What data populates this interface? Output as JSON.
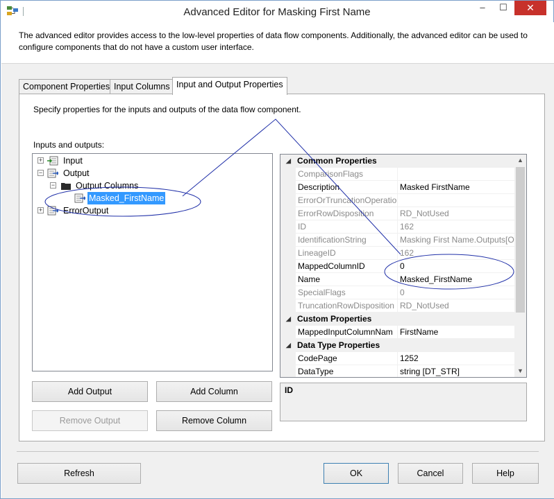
{
  "window": {
    "title": "Advanced Editor for Masking First Name",
    "description": "The advanced editor provides access to the low-level properties of data flow components. Additionally, the advanced editor can be used to configure components that do not have a custom user interface.",
    "controls": {
      "minimize": "‒",
      "maximize": "☐",
      "close": "✕"
    }
  },
  "tabs": [
    {
      "label": "Component Properties",
      "active": false
    },
    {
      "label": "Input Columns",
      "active": false
    },
    {
      "label": "Input and Output Properties",
      "active": true
    }
  ],
  "panel": {
    "info": "Specify properties for the inputs and outputs of the data flow component.",
    "tree_label": "Inputs and outputs:"
  },
  "tree": {
    "input": {
      "label": "Input",
      "expander": "+"
    },
    "output": {
      "label": "Output",
      "expander": "−"
    },
    "output_columns": {
      "label": "Output Columns",
      "expander": "−"
    },
    "masked_firstname": {
      "label": "Masked_FirstName",
      "selected": true
    },
    "error_output": {
      "label": "ErrorOutput",
      "expander": "+"
    }
  },
  "buttons": {
    "add_output": "Add Output",
    "add_column": "Add Column",
    "remove_output": "Remove Output",
    "remove_column": "Remove Column",
    "refresh": "Refresh",
    "ok": "OK",
    "cancel": "Cancel",
    "help": "Help"
  },
  "property_grid": {
    "common": {
      "label": "Common Properties",
      "rows": [
        {
          "name": "ComparisonFlags",
          "value": "",
          "readonly": true
        },
        {
          "name": "Description",
          "value": "Masked FirstName",
          "readonly": false
        },
        {
          "name": "ErrorOrTruncationOperatio",
          "value": "",
          "readonly": true
        },
        {
          "name": "ErrorRowDisposition",
          "value": "RD_NotUsed",
          "readonly": true
        },
        {
          "name": "ID",
          "value": "162",
          "readonly": true
        },
        {
          "name": "IdentificationString",
          "value": "Masking First Name.Outputs[O",
          "readonly": true
        },
        {
          "name": "LineageID",
          "value": "162",
          "readonly": true
        },
        {
          "name": "MappedColumnID",
          "value": "0",
          "readonly": false
        },
        {
          "name": "Name",
          "value": "Masked_FirstName",
          "readonly": false
        },
        {
          "name": "SpecialFlags",
          "value": "0",
          "readonly": true
        },
        {
          "name": "TruncationRowDisposition",
          "value": "RD_NotUsed",
          "readonly": true
        }
      ]
    },
    "custom": {
      "label": "Custom Properties",
      "rows": [
        {
          "name": "MappedInputColumnNam",
          "value": "FirstName",
          "readonly": false
        }
      ]
    },
    "datatype": {
      "label": "Data Type Properties",
      "rows": [
        {
          "name": "CodePage",
          "value": "1252",
          "readonly": false
        },
        {
          "name": "DataType",
          "value": "string [DT_STR]",
          "readonly": false
        }
      ]
    },
    "toggle_glyph": "◢",
    "scroll_up": "▲",
    "scroll_down": "▼"
  },
  "description_box": {
    "title": "ID"
  },
  "colors": {
    "selection": "#3399ff",
    "annotation": "#1f2fa8",
    "close_button": "#c7312b"
  }
}
